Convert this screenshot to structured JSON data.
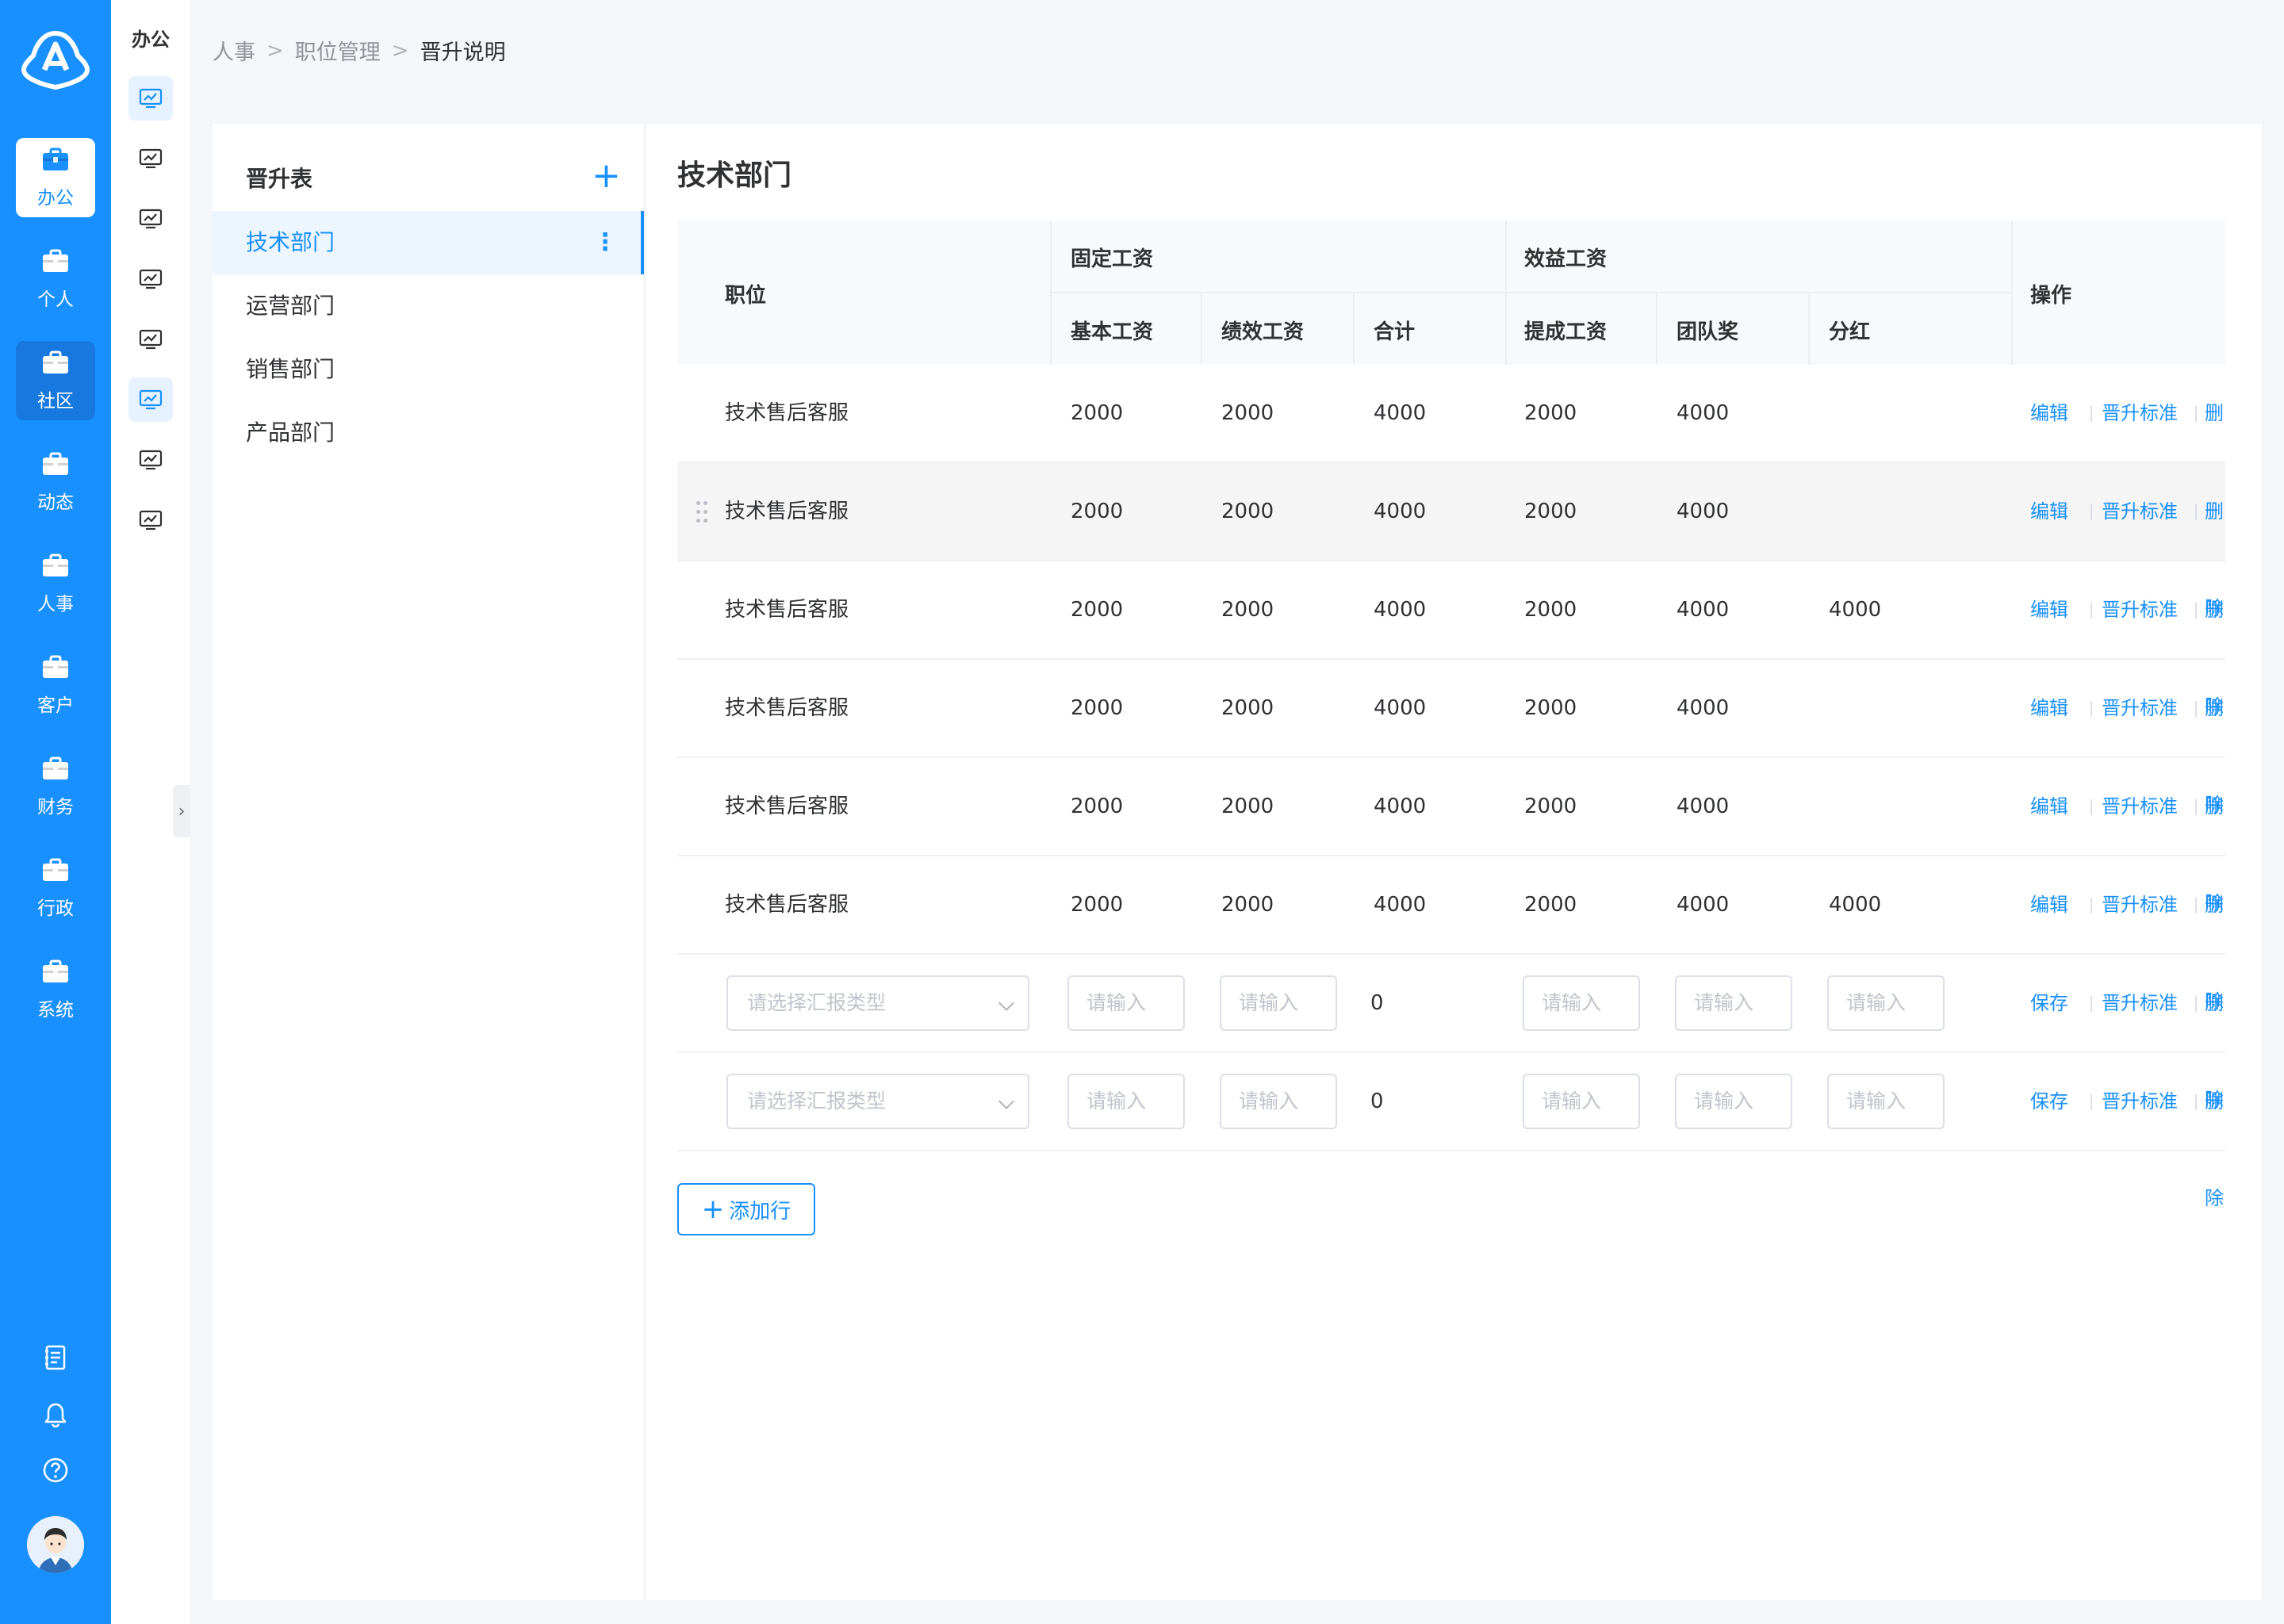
{
  "rail": {
    "items": [
      {
        "label": "办公",
        "icon": "briefcase-icon",
        "active": true
      },
      {
        "label": "个人",
        "icon": "briefcase-icon"
      },
      {
        "label": "社区",
        "icon": "briefcase-icon"
      },
      {
        "label": "动态",
        "icon": "briefcase-icon"
      },
      {
        "label": "人事",
        "icon": "briefcase-icon"
      },
      {
        "label": "客户",
        "icon": "briefcase-icon"
      },
      {
        "label": "财务",
        "icon": "briefcase-icon"
      },
      {
        "label": "行政",
        "icon": "briefcase-icon"
      },
      {
        "label": "系统",
        "icon": "briefcase-icon"
      }
    ],
    "bottom_icons": [
      "document-icon",
      "bell-icon",
      "help-icon"
    ]
  },
  "subrail": {
    "title": "办公",
    "icon": "monitor-chart-icon"
  },
  "breadcrumb": [
    "人事",
    "职位管理",
    "晋升说明"
  ],
  "dept": {
    "header": "晋升表",
    "items": [
      "技术部门",
      "运营部门",
      "销售部门",
      "产品部门"
    ]
  },
  "content": {
    "title": "技术部门"
  },
  "table": {
    "headers": {
      "position": "职位",
      "fixed_group": "固定工资",
      "bonus_group": "效益工资",
      "ops": "操作",
      "base": "基本工资",
      "perf": "绩效工资",
      "total": "合计",
      "commission": "提成工资",
      "team": "团队奖",
      "dividend": "分红"
    },
    "rows": [
      {
        "position": "技术售后客服",
        "base": "2000",
        "perf": "2000",
        "total": "4000",
        "commission": "2000",
        "team": "4000",
        "dividend": ""
      },
      {
        "position": "技术售后客服",
        "base": "2000",
        "perf": "2000",
        "total": "4000",
        "commission": "2000",
        "team": "4000",
        "dividend": ""
      },
      {
        "position": "技术售后客服",
        "base": "2000",
        "perf": "2000",
        "total": "4000",
        "commission": "2000",
        "team": "4000",
        "dividend": "4000"
      },
      {
        "position": "技术售后客服",
        "base": "2000",
        "perf": "2000",
        "total": "4000",
        "commission": "2000",
        "team": "4000",
        "dividend": ""
      },
      {
        "position": "技术售后客服",
        "base": "2000",
        "perf": "2000",
        "total": "4000",
        "commission": "2000",
        "team": "4000",
        "dividend": ""
      },
      {
        "position": "技术售后客服",
        "base": "2000",
        "perf": "2000",
        "total": "4000",
        "commission": "2000",
        "team": "4000",
        "dividend": "4000"
      }
    ],
    "edit_rows": [
      {
        "select_placeholder": "请选择汇报类型",
        "input_placeholder": "请输入",
        "total": "0"
      },
      {
        "select_placeholder": "请选择汇报类型",
        "input_placeholder": "请输入",
        "total": "0"
      }
    ],
    "ops": {
      "edit": "编辑",
      "standard": "晋升标准",
      "delete": "删除",
      "save": "保存"
    }
  },
  "add_row_label": "添加行",
  "colors": {
    "primary": "#1890ff",
    "rail_bg": "#1890ff"
  }
}
